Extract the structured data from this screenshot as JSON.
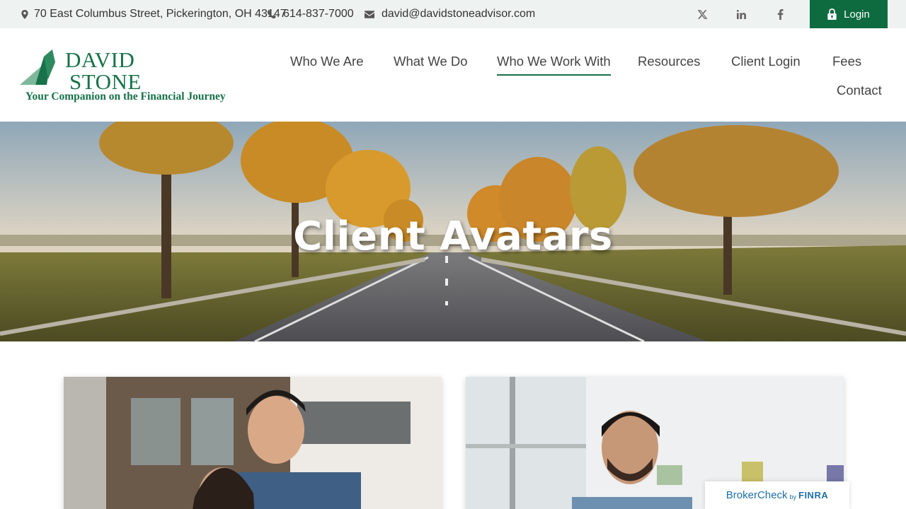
{
  "topbar": {
    "address": "70 East Columbus Street, Pickerington, OH 43147",
    "phone": "614-837-7000",
    "email": "david@davidstoneadvisor.com",
    "social": [
      "x-icon",
      "linkedin-icon",
      "facebook-icon"
    ],
    "login_label": "Login"
  },
  "logo": {
    "line1": "DAVID",
    "line2": "STONE",
    "tagline": "Your Companion on the Financial Journey"
  },
  "nav": {
    "items": [
      {
        "label": "Who We Are"
      },
      {
        "label": "What We Do"
      },
      {
        "label": "Who We Work With",
        "active": true
      },
      {
        "label": "Resources"
      },
      {
        "label": "Client Login"
      },
      {
        "label": "Fees"
      },
      {
        "label": "Contact"
      }
    ]
  },
  "hero": {
    "title": "Client Avatars"
  },
  "broker_check": {
    "brand": "BrokerCheck",
    "by": "by",
    "org": "FINRA"
  },
  "colors": {
    "brand_green": "#0d6b3f",
    "logo_green": "#17724a",
    "topbar_bg": "#eef2f0"
  }
}
